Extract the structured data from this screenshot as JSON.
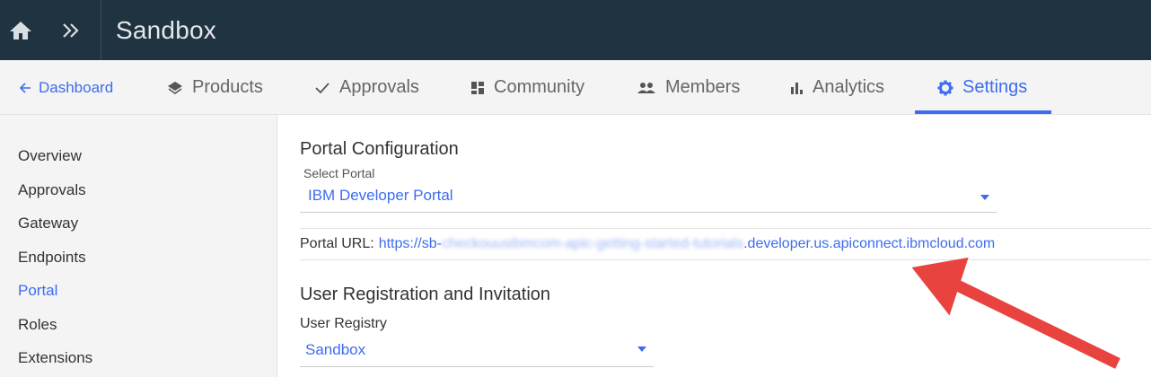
{
  "topbar": {
    "title": "Sandbox",
    "home_icon": "home-icon",
    "expand_icon": "double-chevron-right-icon"
  },
  "tabs": [
    {
      "label": "Dashboard",
      "icon": "arrow-left-icon"
    },
    {
      "label": "Products",
      "icon": "layers-icon"
    },
    {
      "label": "Approvals",
      "icon": "check-icon"
    },
    {
      "label": "Community",
      "icon": "grid-icon"
    },
    {
      "label": "Members",
      "icon": "people-icon"
    },
    {
      "label": "Analytics",
      "icon": "bar-chart-icon"
    },
    {
      "label": "Settings",
      "icon": "gear-icon",
      "active": true
    }
  ],
  "sidebar": {
    "items": [
      {
        "label": "Overview"
      },
      {
        "label": "Approvals"
      },
      {
        "label": "Gateway"
      },
      {
        "label": "Endpoints"
      },
      {
        "label": "Portal",
        "active": true
      },
      {
        "label": "Roles"
      },
      {
        "label": "Extensions"
      }
    ]
  },
  "portal_config": {
    "heading": "Portal Configuration",
    "select_label": "Select Portal",
    "select_value": "IBM Developer Portal",
    "url_label": "Portal URL:",
    "url_prefix": "https://sb-",
    "url_blurred": "checkouusibmcom-apic-getting-started-tutorials",
    "url_suffix": ".developer.us.apiconnect.ibmcloud.com"
  },
  "user_registration": {
    "heading": "User Registration and Invitation",
    "registry_label": "User Registry",
    "registry_value": "Sandbox"
  },
  "colors": {
    "accent": "#3c6df0",
    "topbar_bg": "#1f3340",
    "annotation_arrow": "#e8433f"
  }
}
